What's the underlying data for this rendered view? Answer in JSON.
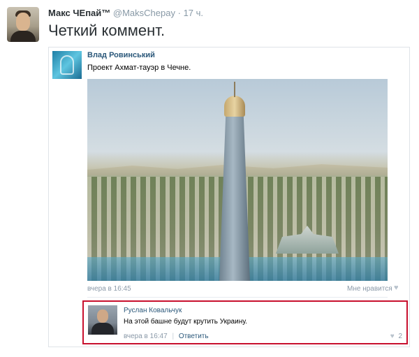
{
  "tweet": {
    "author_name": "Макс ЧЕпай™",
    "handle": "@MaksChepay",
    "separator": "·",
    "time": "17 ч.",
    "text": "Четкий коммент."
  },
  "post": {
    "author": "Влад Ровинський",
    "text": "Проект Ахмат-тауэр в Чечне.",
    "date": "вчера в 16:45",
    "like_label": "Мне нравится",
    "like_icon": "heart-icon"
  },
  "comment": {
    "author": "Руслан Ковальчук",
    "text": "На этой башне будут крутить Украину.",
    "date": "вчера в 16:47",
    "divider": "|",
    "reply_label": "Ответить",
    "like_count": "2",
    "highlight_color": "#c8102e"
  }
}
